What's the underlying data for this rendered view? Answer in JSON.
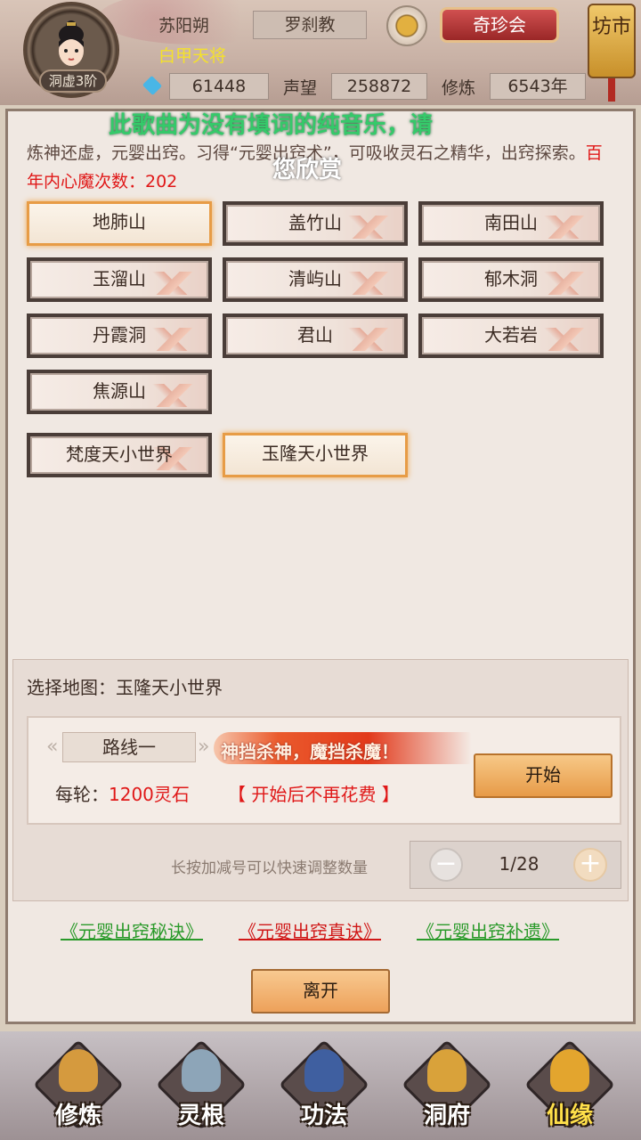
{
  "header": {
    "avatar_rank": "洞虚3阶",
    "player_name": "苏阳朔",
    "player_title": "白甲天将",
    "sect": "罗刹教",
    "treasure_button": "奇珍会",
    "market_button": "坊市",
    "spirit_stones": "61448",
    "reputation_label": "声望",
    "reputation": "258872",
    "cultivation_label": "修炼",
    "cultivation": "6543年"
  },
  "overlay_notice": {
    "line1": "此歌曲为没有填词的纯音乐，请",
    "line2": "您欣赏"
  },
  "description": {
    "text": "炼神还虚，元婴出窍。习得“元婴出窍术”，可吸收灵石之精华，出窍探索。",
    "highlight": "百年内心魔次数：202"
  },
  "maps": [
    {
      "label": "地肺山",
      "selected": true
    },
    {
      "label": "盖竹山",
      "selected": false
    },
    {
      "label": "南田山",
      "selected": false
    },
    {
      "label": "玉溜山",
      "selected": false
    },
    {
      "label": "清屿山",
      "selected": false
    },
    {
      "label": "郁木洞",
      "selected": false
    },
    {
      "label": "丹霞洞",
      "selected": false
    },
    {
      "label": "君山",
      "selected": false
    },
    {
      "label": "大若岩",
      "selected": false
    },
    {
      "label": "焦源山",
      "selected": false
    }
  ],
  "worlds": [
    {
      "label": "梵度天小世界",
      "selected": false
    },
    {
      "label": "玉隆天小世界",
      "selected": true
    }
  ],
  "selection": {
    "selected_map": "选择地图：玉隆天小世界",
    "route": "路线一",
    "slogan": "神挡杀神，魔挡杀魔！",
    "cost_label": "每轮：",
    "cost_value": "1200灵石",
    "cost_note": "【 开始后不再花费 】",
    "start_button": "开始",
    "hint": "长按加减号可以快速调整数量",
    "counter": "1/28"
  },
  "links": [
    {
      "label": "《元婴出窍秘诀》",
      "color": "#2a9a2a"
    },
    {
      "label": "《元婴出窍真诀》",
      "color": "#d01818"
    },
    {
      "label": "《元婴出窍补遗》",
      "color": "#2a9a2a"
    }
  ],
  "leave_button": "离开",
  "bottom_nav": [
    {
      "label": "修炼",
      "icon": "monk-icon"
    },
    {
      "label": "灵根",
      "icon": "sword-icon"
    },
    {
      "label": "功法",
      "icon": "book-icon"
    },
    {
      "label": "洞府",
      "icon": "pavilion-icon"
    },
    {
      "label": "仙缘",
      "icon": "gourd-icon",
      "active": true
    }
  ]
}
